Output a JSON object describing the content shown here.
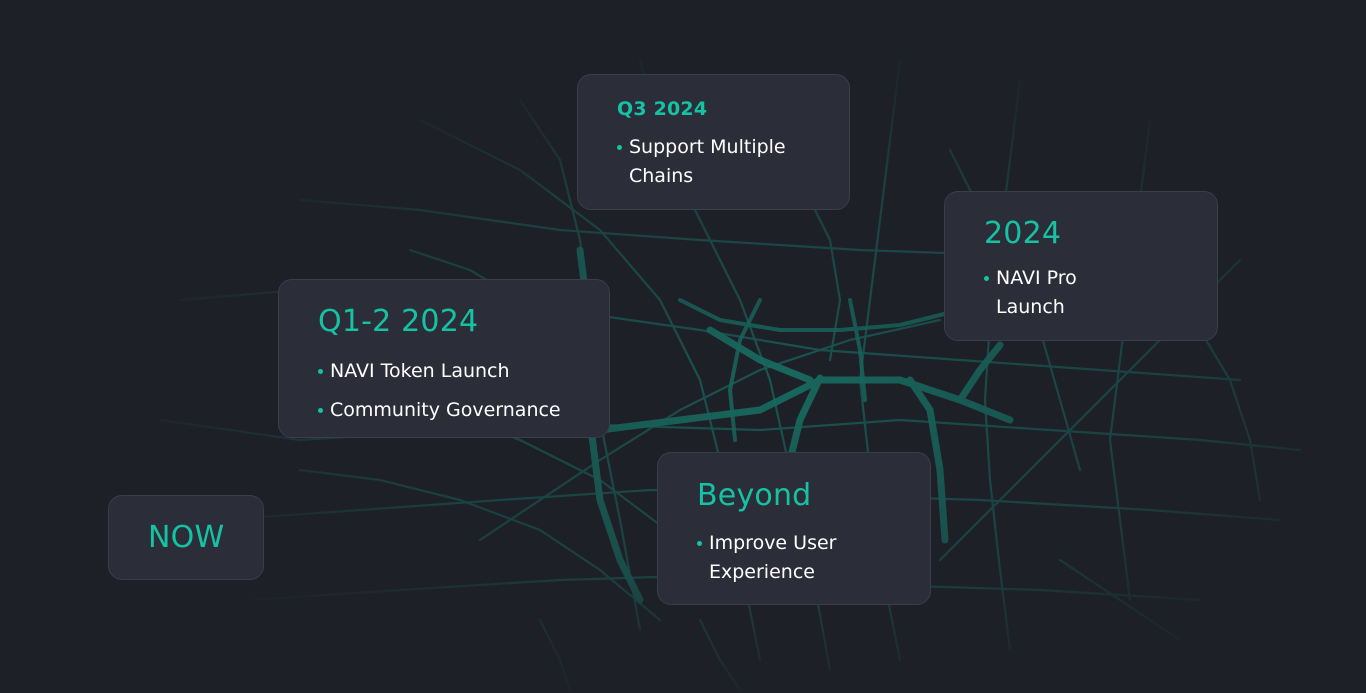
{
  "colors": {
    "background": "#1e2028",
    "card_background": "#2b2e38",
    "accent": "#15c3a4",
    "road": "#0f9e85",
    "text": "#ffffff"
  },
  "roadmap": {
    "now": {
      "title": "NOW"
    },
    "q12_2024": {
      "title": "Q1-2 2024",
      "items": [
        "NAVI Token Launch",
        "Community Governance"
      ]
    },
    "q3_2024": {
      "title": "Q3 2024",
      "items": [
        "Support Multiple",
        "Chains"
      ]
    },
    "y2024": {
      "title": "2024",
      "items": [
        "NAVI Pro",
        "Launch"
      ]
    },
    "beyond": {
      "title": "Beyond",
      "items": [
        "Improve User",
        "Experience"
      ]
    }
  }
}
